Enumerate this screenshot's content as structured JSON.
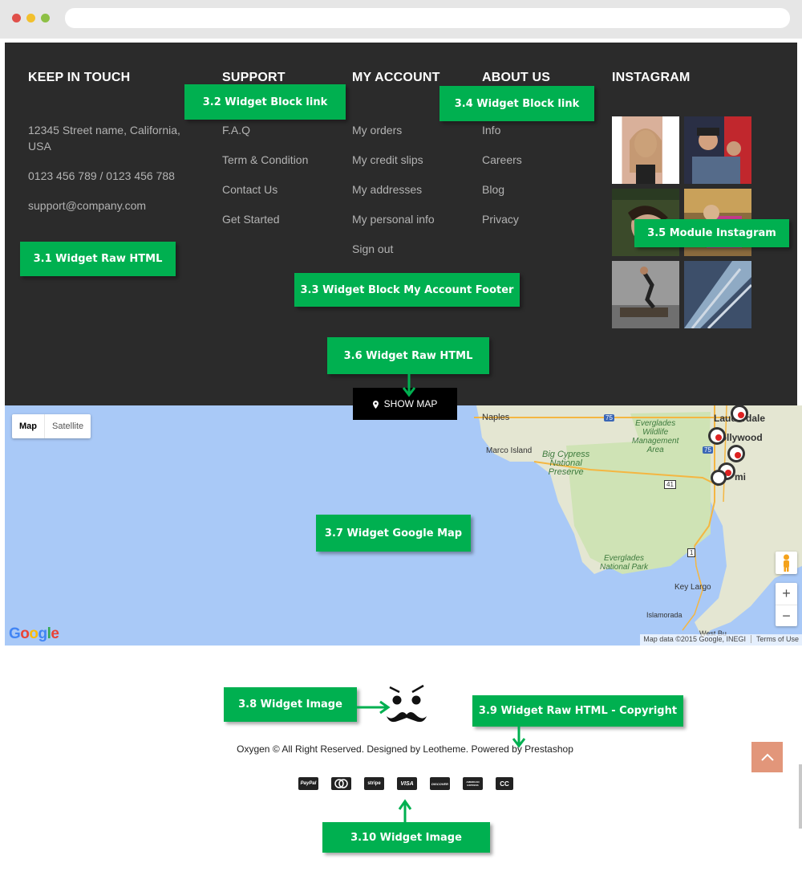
{
  "footer": {
    "keep_in_touch": {
      "title": "KEEP IN TOUCH",
      "address_line1": "12345 Street name, California,",
      "address_line2": "USA",
      "phone": "0123 456 789 / 0123 456 788",
      "email": "support@company.com"
    },
    "support": {
      "title": "SUPPORT",
      "links": [
        "F.A.Q",
        "Term & Condition",
        "Contact Us",
        "Get Started"
      ]
    },
    "my_account": {
      "title": "MY ACCOUNT",
      "links": [
        "My orders",
        "My credit slips",
        "My addresses",
        "My personal info",
        "Sign out"
      ]
    },
    "about_us": {
      "title": "ABOUT US",
      "links": [
        "Info",
        "Careers",
        "Blog",
        "Privacy"
      ]
    },
    "instagram": {
      "title": "INSTAGRAM"
    },
    "show_map_label": "SHOW MAP"
  },
  "annotations": {
    "a1": "3.1 Widget Raw HTML",
    "a2": "3.2 Widget Block link",
    "a3": "3.3 Widget Block My Account Footer",
    "a4": "3.4  Widget Block link",
    "a5": "3.5 Module Instagram",
    "a6": "3.6 Widget Raw HTML",
    "a7": "3.7 Widget Google Map",
    "a8": "3.8 Widget Image",
    "a9": "3.9 Widget Raw HTML - Copyright",
    "a10": "3.10 Widget Image"
  },
  "map": {
    "toggle_map": "Map",
    "toggle_satellite": "Satellite",
    "labels": {
      "naples": "Naples",
      "marco_island": "Marco Island",
      "big_cypress": [
        "Big Cypress",
        "National",
        "Preserve"
      ],
      "everglades_wma": [
        "Everglades",
        "Wildlife",
        "Management",
        "Area"
      ],
      "everglades_np": [
        "Everglades",
        "National Park"
      ],
      "lauderdale": "Lauderdale",
      "hollywood": "Hollywood",
      "miami": "mi",
      "key_largo": "Key Largo",
      "islamorada": "Islamorada",
      "west_buffer": "West Bu",
      "hw75a": "75",
      "hw75b": "75",
      "hw41": "41",
      "hw1": "1"
    },
    "attribution": "Map data ©2015 Google, INEGI",
    "terms": "Terms of Use",
    "logo": "Google",
    "zoom_in": "+",
    "zoom_out": "−"
  },
  "bottom": {
    "copyright": "Oxygen © All Right Reserved. Designed by Leotheme. Powered by Prestashop",
    "payments": [
      "PayPal",
      "MasterCard",
      "stripe",
      "VISA",
      "DISCOVER",
      "AMERICAN EXPRESS",
      "CC"
    ]
  },
  "colors": {
    "annotation_green": "#00b050",
    "footer_bg": "#2b2b2b",
    "to_top_bg": "#e2967a"
  }
}
